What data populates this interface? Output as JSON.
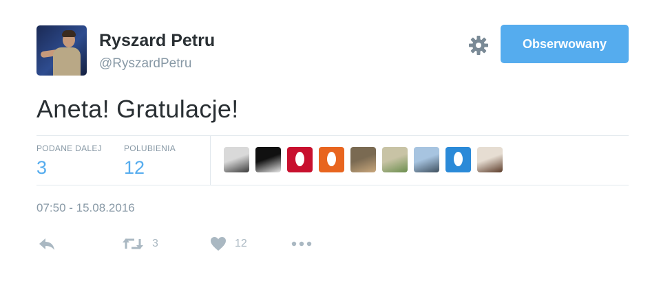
{
  "profile": {
    "name": "Ryszard Petru",
    "handle": "@RyszardPetru"
  },
  "follow_button": {
    "label": "Obserwowany",
    "color": "#55acee"
  },
  "tweet": {
    "text": "Aneta! Gratulacje!"
  },
  "stats": {
    "retweets": {
      "label": "PODANE DALEJ",
      "value": "3"
    },
    "likes": {
      "label": "POLUBIENIA",
      "value": "12"
    }
  },
  "likers": [
    {
      "kind": "photo",
      "colors": [
        "#d9d9d9",
        "#3a3a3a"
      ]
    },
    {
      "kind": "photo",
      "colors": [
        "#111111",
        "#e8e8e8"
      ]
    },
    {
      "kind": "egg",
      "colors": [
        "#c8102e"
      ]
    },
    {
      "kind": "egg",
      "colors": [
        "#e8651f"
      ]
    },
    {
      "kind": "photo",
      "colors": [
        "#7a6a52",
        "#c9a77c"
      ]
    },
    {
      "kind": "photo",
      "colors": [
        "#c8c3a5",
        "#6b8e4e"
      ]
    },
    {
      "kind": "photo",
      "colors": [
        "#a7c4e0",
        "#3e4f5e"
      ]
    },
    {
      "kind": "egg",
      "colors": [
        "#2b8ad8"
      ]
    },
    {
      "kind": "photo",
      "colors": [
        "#e6ddd2",
        "#5a3a28"
      ]
    }
  ],
  "timestamp": "07:50 - 15.08.2016",
  "actions": {
    "reply": {
      "icon": "reply-icon"
    },
    "retweet": {
      "icon": "retweet-icon",
      "count": "3"
    },
    "like": {
      "icon": "heart-icon",
      "count": "12"
    },
    "more": {
      "icon": "more-icon"
    }
  },
  "colors": {
    "text": "#292f33",
    "muted": "#8899a6",
    "accent": "#55acee",
    "action_gray": "#aab8c2"
  }
}
